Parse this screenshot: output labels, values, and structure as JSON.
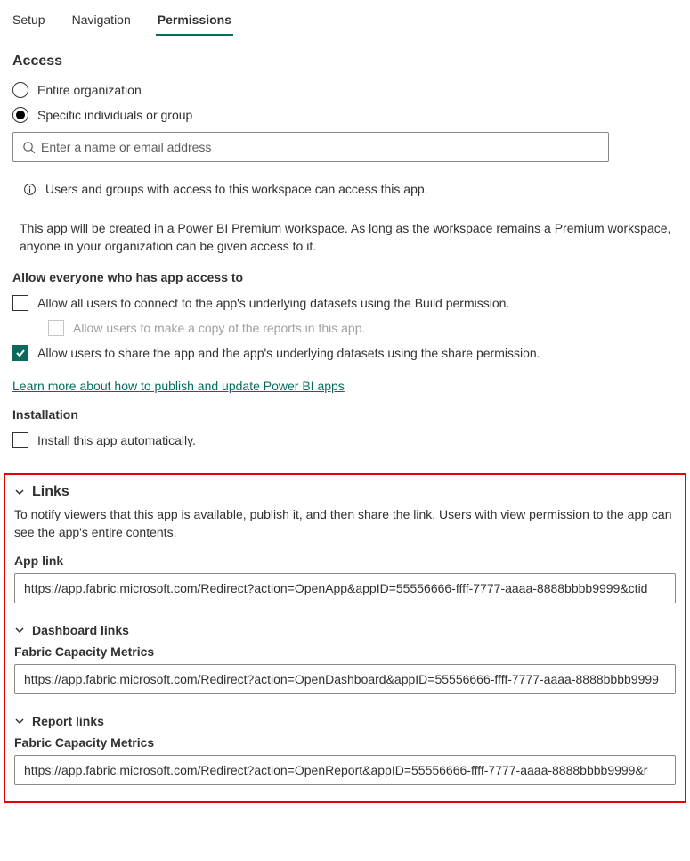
{
  "tabs": {
    "setup": "Setup",
    "navigation": "Navigation",
    "permissions": "Permissions"
  },
  "access": {
    "heading": "Access",
    "radio_entire": "Entire organization",
    "radio_specific": "Specific individuals or group",
    "search_placeholder": "Enter a name or email address",
    "info_text": "Users and groups with access to this workspace can access this app."
  },
  "premium_note": "This app will be created in a Power BI Premium workspace. As long as the workspace remains a Premium workspace, anyone in your organization can be given access to it.",
  "allow": {
    "heading": "Allow everyone who has app access to",
    "build": "Allow all users to connect to the app's underlying datasets using the Build permission.",
    "copy": "Allow users to make a copy of the reports in this app.",
    "share": "Allow users to share the app and the app's underlying datasets using the share permission."
  },
  "learn_more": "Learn more about how to publish and update Power BI apps",
  "installation": {
    "heading": "Installation",
    "auto": "Install this app automatically."
  },
  "links": {
    "heading": "Links",
    "desc": "To notify viewers that this app is available, publish it, and then share the link. Users with view permission to the app can see the app's entire contents.",
    "app_link_label": "App link",
    "app_link_value": "https://app.fabric.microsoft.com/Redirect?action=OpenApp&appID=55556666-ffff-7777-aaaa-8888bbbb9999&ctid",
    "dashboard_heading": "Dashboard links",
    "dashboard_label": "Fabric Capacity Metrics",
    "dashboard_value": "https://app.fabric.microsoft.com/Redirect?action=OpenDashboard&appID=55556666-ffff-7777-aaaa-8888bbbb9999",
    "report_heading": "Report links",
    "report_label": "Fabric Capacity Metrics",
    "report_value": "https://app.fabric.microsoft.com/Redirect?action=OpenReport&appID=55556666-ffff-7777-aaaa-8888bbbb9999&r"
  }
}
